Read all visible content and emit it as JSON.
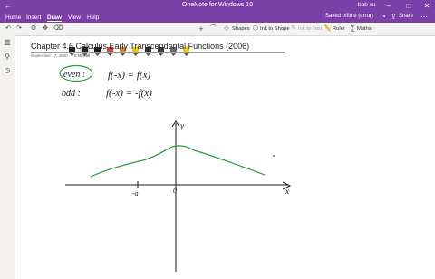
{
  "window": {
    "title": "OneNote for Windows 10",
    "user": "bob xu"
  },
  "menu": {
    "tabs": [
      "Home",
      "Insert",
      "Draw",
      "View",
      "Help"
    ],
    "active_tab": "Draw",
    "status": "Saved offline (error)",
    "share_label": "Share"
  },
  "ribbon": {
    "shapes_label": "Shapes",
    "ink_to_shape_label": "Ink to Shape",
    "ink_to_text_label": "Ink to Text",
    "ruler_label": "Ruler",
    "math_label": "Maths",
    "pen_colors": [
      "#222222",
      "#222222",
      "#1a1a1a",
      "#e23b3b",
      "#e8862c",
      "#f2c500",
      "#2f2f2f",
      "#3a3a3a",
      "#6b6b6b",
      "#f0d000"
    ]
  },
  "page": {
    "title": "Chapter 4.6 Calculus Early Transcendental Functions (2006)",
    "date": "September 17, 2020",
    "time": "5:06 PM"
  },
  "notes": {
    "even_label": "even :",
    "even_eq": "f(-x) = f(x)",
    "odd_label": "odd :",
    "odd_eq": "f(-x) = -f(x)",
    "graph_y_label": "y",
    "graph_x_label": "x",
    "graph_neg_a": "-a",
    "graph_origin": "0"
  },
  "colors": {
    "accent": "#7b3fa8",
    "curve": "#2e9a3e",
    "ink": "#1a1a1a",
    "even_circle": "#2e9a3e"
  }
}
